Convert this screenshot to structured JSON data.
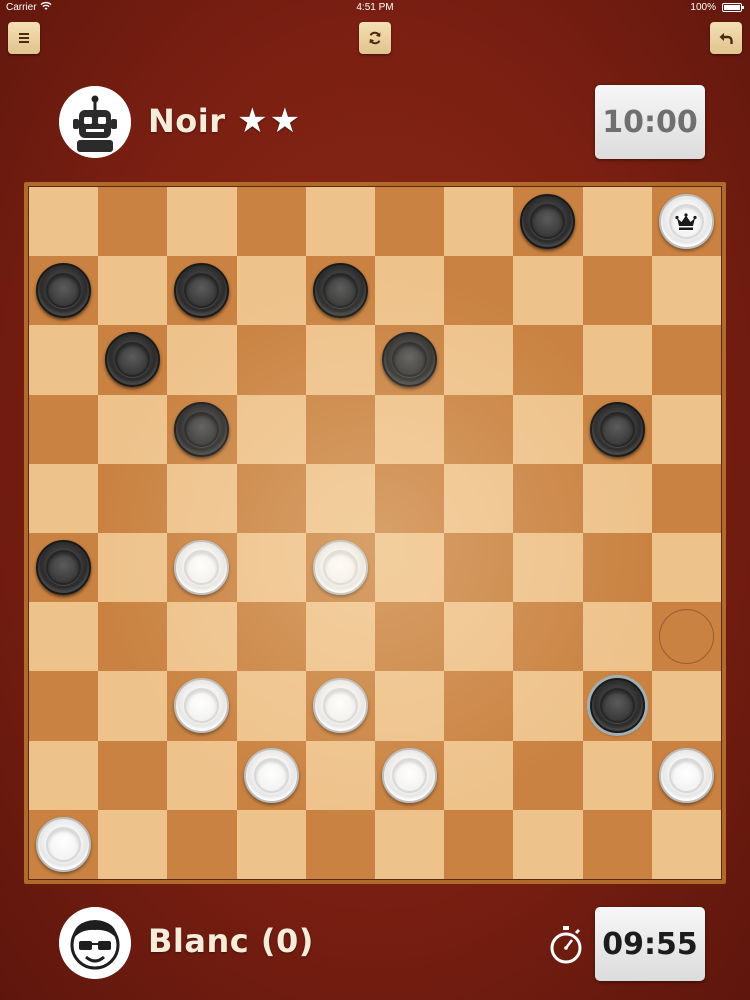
{
  "status_bar": {
    "carrier": "Carrier",
    "time": "4:51 PM",
    "battery": "100%"
  },
  "toolbar": {
    "menu_icon": "hamburger-menu-icon",
    "restart_icon": "refresh-icon",
    "undo_icon": "undo-arrow-icon"
  },
  "opponent": {
    "name": "Noir",
    "level": "★★",
    "avatar_icon": "robot-avatar-icon",
    "clock": "10:00"
  },
  "player": {
    "name": "Blanc (0)",
    "avatar_icon": "boy-glasses-avatar-icon",
    "clock": "09:55",
    "clock_icon": "stopwatch-icon"
  },
  "board": {
    "size": 10,
    "colors": {
      "light": "#eec28b",
      "dark": "#c98241"
    },
    "pieces": [
      {
        "row": 0,
        "col": 7,
        "color": "black"
      },
      {
        "row": 0,
        "col": 9,
        "color": "white",
        "king": true
      },
      {
        "row": 1,
        "col": 0,
        "color": "black"
      },
      {
        "row": 1,
        "col": 2,
        "color": "black"
      },
      {
        "row": 1,
        "col": 4,
        "color": "black"
      },
      {
        "row": 2,
        "col": 1,
        "color": "black"
      },
      {
        "row": 2,
        "col": 5,
        "color": "black"
      },
      {
        "row": 3,
        "col": 2,
        "color": "black"
      },
      {
        "row": 3,
        "col": 8,
        "color": "black"
      },
      {
        "row": 5,
        "col": 0,
        "color": "black"
      },
      {
        "row": 5,
        "col": 2,
        "color": "white"
      },
      {
        "row": 5,
        "col": 4,
        "color": "white"
      },
      {
        "row": 7,
        "col": 2,
        "color": "white"
      },
      {
        "row": 7,
        "col": 4,
        "color": "white"
      },
      {
        "row": 7,
        "col": 8,
        "color": "black",
        "selected": true
      },
      {
        "row": 8,
        "col": 3,
        "color": "white"
      },
      {
        "row": 8,
        "col": 5,
        "color": "white"
      },
      {
        "row": 8,
        "col": 9,
        "color": "white"
      },
      {
        "row": 9,
        "col": 0,
        "color": "white"
      }
    ],
    "move_targets": [
      {
        "row": 6,
        "col": 9
      }
    ]
  }
}
